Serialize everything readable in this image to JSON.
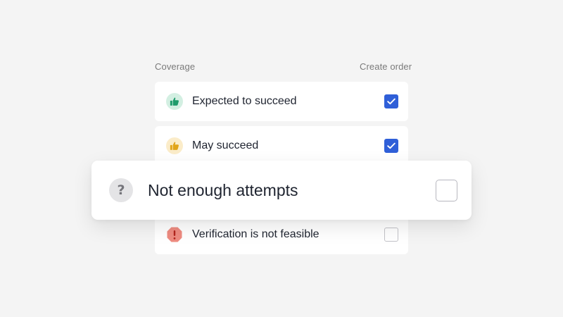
{
  "header": {
    "coverage_label": "Coverage",
    "create_order_label": "Create order"
  },
  "rows": [
    {
      "label": "Expected to succeed",
      "icon": "thumbs-up-icon",
      "icon_color": "#1e9b6b",
      "icon_bg": "#d3efe2",
      "checked": true
    },
    {
      "label": "May succeed",
      "icon": "thumbs-up-icon",
      "icon_color": "#e0a41a",
      "icon_bg": "#fbecc9",
      "checked": true
    },
    {
      "label": "Not enough attempts",
      "icon": "question-icon",
      "icon_color": "#75757b",
      "icon_bg": "#e4e4e6",
      "checked": false
    },
    {
      "label": "Verification is not feasible",
      "icon": "warning-octagon-icon",
      "icon_color": "#ee8b80",
      "checked": false
    }
  ],
  "icon_glyphs": {
    "question": "?"
  },
  "colors": {
    "background": "#f4f4f4",
    "checkbox_checked": "#2f5fd8",
    "checkbox_unchecked_border": "#c3c3c8"
  }
}
